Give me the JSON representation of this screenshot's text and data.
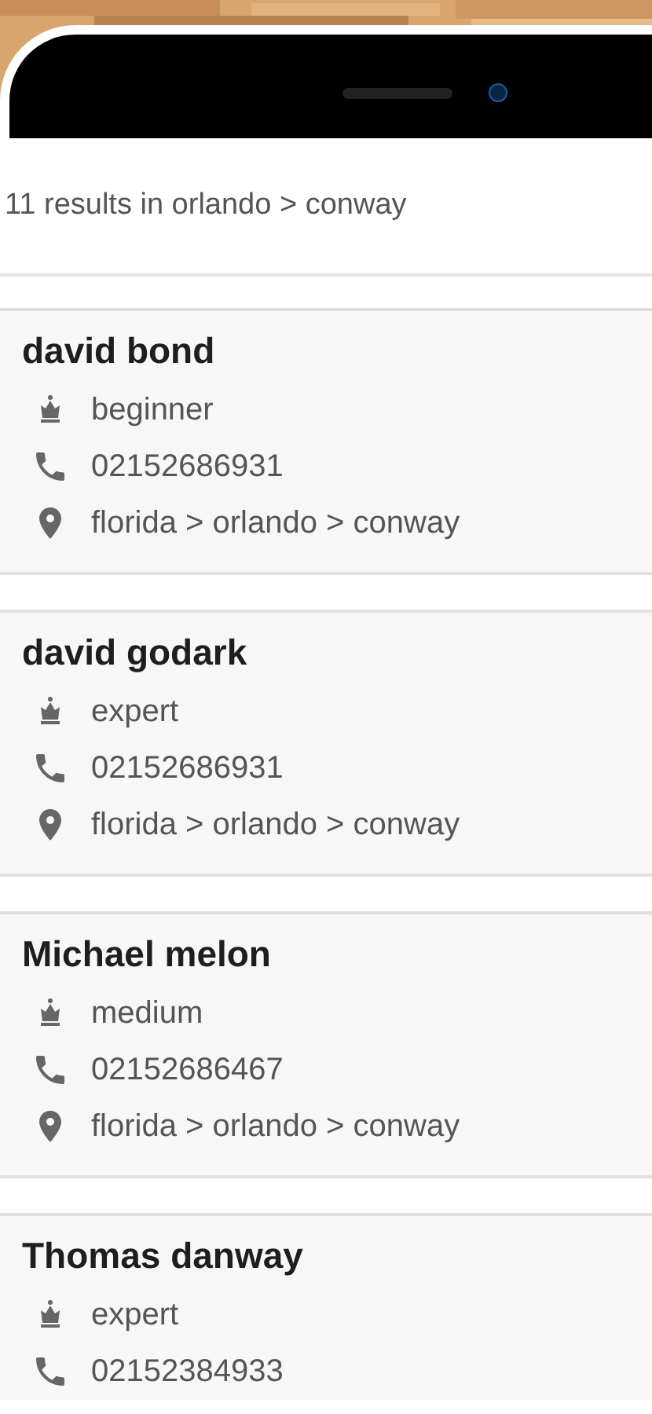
{
  "header": {
    "results": "11 results in orlando > conway"
  },
  "listings": [
    {
      "name": "david bond",
      "level": "beginner",
      "phone": "02152686931",
      "location": "florida > orlando > conway"
    },
    {
      "name": "david godark",
      "level": "expert",
      "phone": "02152686931",
      "location": "florida > orlando > conway"
    },
    {
      "name": "Michael melon",
      "level": "medium",
      "phone": "02152686467",
      "location": "florida > orlando > conway"
    },
    {
      "name": "Thomas danway",
      "level": "expert",
      "phone": "02152384933"
    }
  ]
}
